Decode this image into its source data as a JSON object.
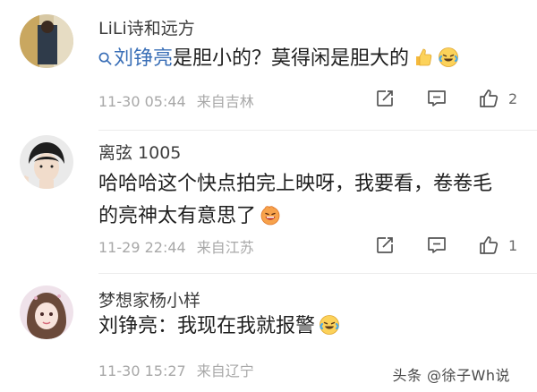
{
  "comments": [
    {
      "username": "LiLi诗和远方",
      "mention": "刘铮亮",
      "text": "是胆小的？莫得闲是胆大的",
      "emojis": [
        "thumbs-up-emoji",
        "laughing-crying-emoji"
      ],
      "time": "11-30 05:44",
      "location": "来自吉林",
      "like_count": "2"
    },
    {
      "username": "离弦 1005",
      "text_line1": "哈哈哈这个快点拍完上映呀，我要看，卷卷毛",
      "text_line2": "的亮神太有意思了",
      "emojis": [
        "laughing-face-emoji"
      ],
      "time": "11-29 22:44",
      "location": "来自江苏",
      "like_count": "1"
    },
    {
      "username": "梦想家杨小样",
      "text": "刘铮亮：我现在我就报警",
      "emojis": [
        "laughing-crying-emoji"
      ],
      "time": "11-30 15:27",
      "location": "来自辽宁",
      "like_count": ""
    }
  ],
  "watermark": "头条 @徐子Wh说",
  "colors": {
    "mention": "#3a6fb7",
    "meta": "#a8a8a8",
    "username": "#3d3d3d"
  }
}
